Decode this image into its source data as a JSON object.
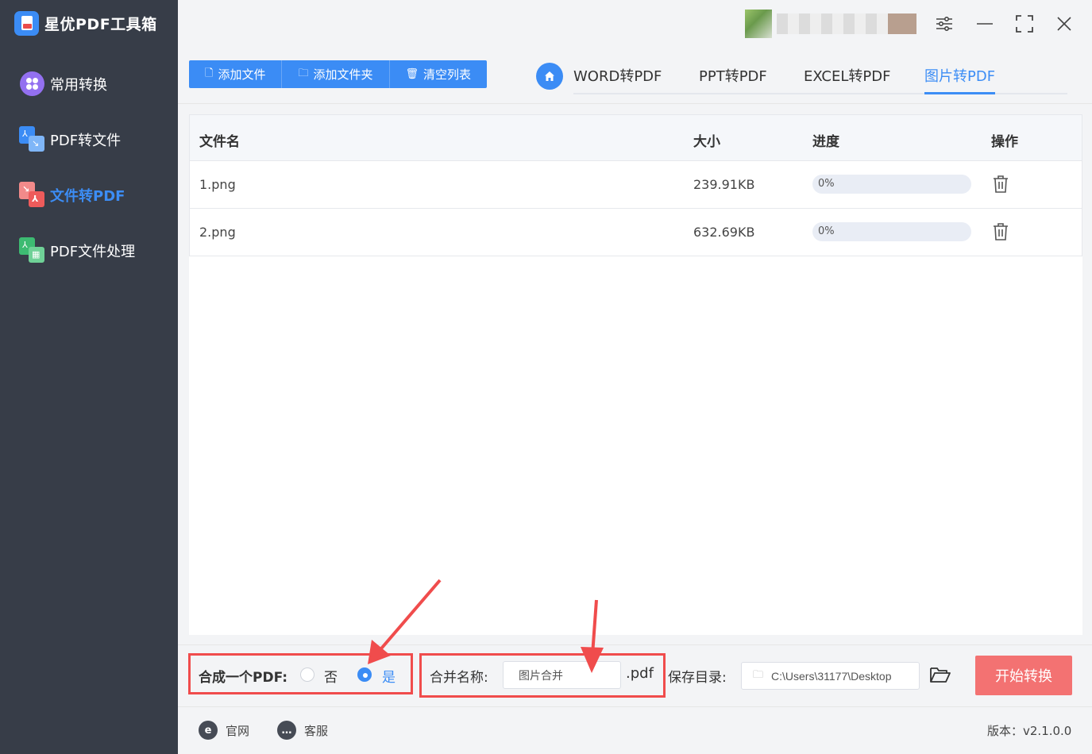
{
  "app": {
    "title": "星优PDF工具箱"
  },
  "sidebar": {
    "items": [
      {
        "label": "常用转换",
        "active": false
      },
      {
        "label": "PDF转文件",
        "active": false
      },
      {
        "label": "文件转PDF",
        "active": true
      },
      {
        "label": "PDF文件处理",
        "active": false
      }
    ]
  },
  "window": {
    "controls": [
      "settings-icon",
      "minimize-icon",
      "fullscreen-icon",
      "close-icon"
    ]
  },
  "toolbar": {
    "add_file": "添加文件",
    "add_folder": "添加文件夹",
    "clear_list": "清空列表"
  },
  "tabs": [
    {
      "label": "WORD转PDF",
      "active": false
    },
    {
      "label": "PPT转PDF",
      "active": false
    },
    {
      "label": "EXCEL转PDF",
      "active": false
    },
    {
      "label": "图片转PDF",
      "active": true
    }
  ],
  "table": {
    "headers": {
      "name": "文件名",
      "size": "大小",
      "progress": "进度",
      "action": "操作"
    },
    "rows": [
      {
        "name": "1.png",
        "size": "239.91KB",
        "progress": "0%",
        "progress_value": 0
      },
      {
        "name": "2.png",
        "size": "632.69KB",
        "progress": "0%",
        "progress_value": 0
      }
    ]
  },
  "options": {
    "merge_label": "合成一个PDF:",
    "no_label": "否",
    "yes_label": "是",
    "merge_selected": "是",
    "merge_name_label": "合并名称:",
    "merge_name_value": "图片合并",
    "ext": ".pdf",
    "save_dir_label": "保存目录:",
    "save_dir_value": "C:\\Users\\31177\\Desktop",
    "start_button": "开始转换"
  },
  "footer": {
    "website": "官网",
    "service": "客服",
    "version": "版本：v2.1.0.0"
  },
  "colors": {
    "accent": "#3b8cf5",
    "sidebar_bg": "#373d48",
    "start_button": "#f37272",
    "highlight_box": "#f04c4c"
  }
}
